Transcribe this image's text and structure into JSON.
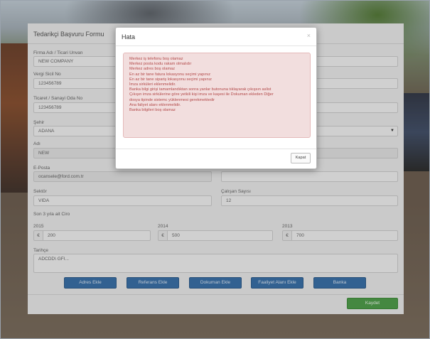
{
  "form": {
    "title": "Tedarikçi Başvuru Formu",
    "company_label": "Firma Adı / Ticari Unvan",
    "company_value": "NEW COMPANY",
    "tax_no_label": "Vergi Sicil No",
    "tax_no_value": "123456789",
    "trade_reg_label": "Ticaret / Sanayi Oda No",
    "trade_reg_value": "123456789",
    "city_label": "Şehir",
    "city_value": "ADANA",
    "name_label": "Adı",
    "name_value": "NEW",
    "email_label": "E-Posta",
    "email_value": "ocansele@ford.com.tr",
    "right_label": "",
    "right_value": "",
    "sector_label": "Sektör",
    "sector_value": "VIDA",
    "employees_label": "Çalışan Sayısı",
    "employees_value": "12",
    "revenue_label": "Son 3 yıla ait Ciro",
    "years": [
      {
        "year": "2015",
        "currency": "€",
        "amount": "200"
      },
      {
        "year": "2014",
        "currency": "€",
        "amount": "500"
      },
      {
        "year": "2013",
        "currency": "€",
        "amount": "700"
      }
    ],
    "history_label": "Tarihçe",
    "history_value": "ADCDD\\ GFI...",
    "buttons": {
      "add_address": "Adres Ekle",
      "add_reference": "Referans Ekle",
      "add_document": "Dokuman Ekle",
      "add_activity": "Faaliyet Alanı Ekle",
      "bank": "Banka"
    },
    "save_label": "Kaydet"
  },
  "modal": {
    "title": "Hata",
    "close_glyph": "×",
    "errors": [
      "Merkez iş telefonu boş olamaz",
      "Merkez posta kodu rakam olmalıdır",
      "Merkez adres boş olamaz",
      "En az bir tane fatura lokasyonu seçimi yapınız",
      "En az bir tane sipariş lokasyonu seçimi yapınız",
      "İmza sirküleri eklenmelidir.",
      "Banka bilgi girişi tamamlandıktan sonra yanlar butonuna tıklayarak çıkışsın aslist",
      "Çıkışın imza sirkülerine göre yetkili kişi imza ve kaşesi ile Dokuman ekleden Diğer",
      "dosya tipinde sistemc yüklenmesi gerekmektedir",
      "Ana faliyet alanı eklenmelidir.",
      "Banka bilgileri boş olamaz"
    ],
    "close_button": "Kapat"
  }
}
